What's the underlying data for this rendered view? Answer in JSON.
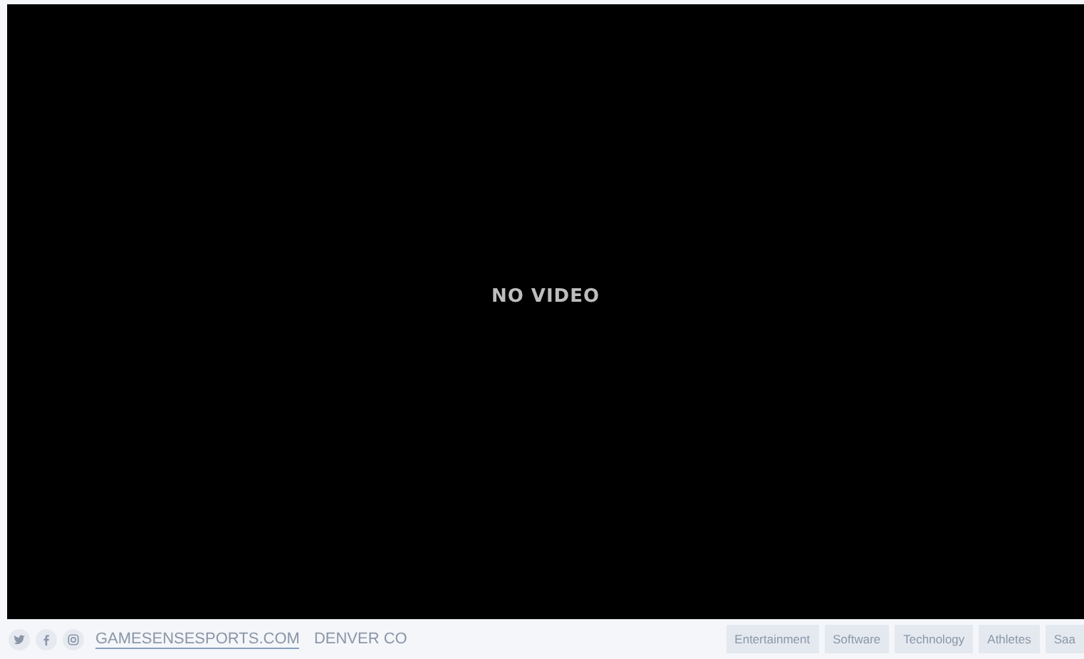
{
  "video": {
    "message": "NO VIDEO"
  },
  "footer": {
    "social": [
      {
        "kind": "twitter"
      },
      {
        "kind": "facebook"
      },
      {
        "kind": "instagram"
      }
    ],
    "site_link": "GAMESENSESPORTS.COM",
    "location": "DENVER CO",
    "tags": [
      "Entertainment",
      "Software",
      "Technology",
      "Athletes",
      "Saa"
    ]
  }
}
